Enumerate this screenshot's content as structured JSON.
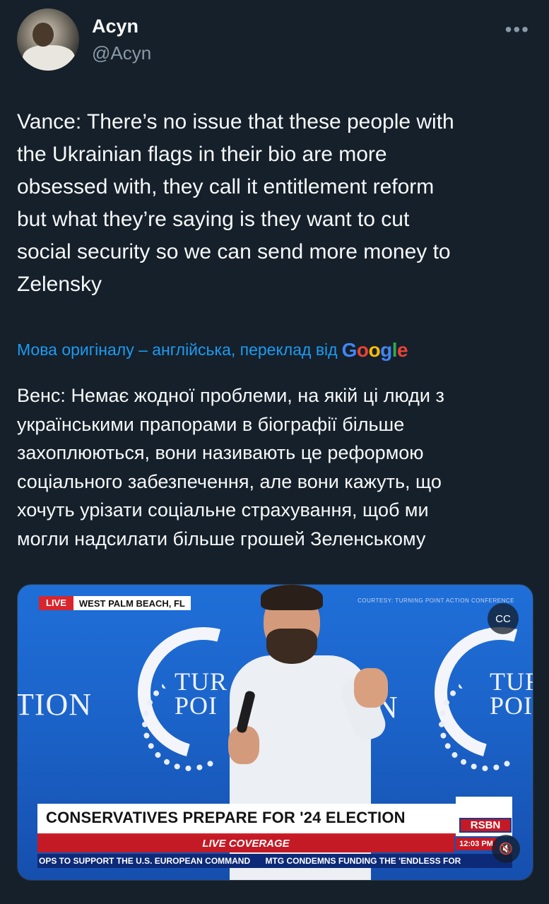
{
  "author": {
    "display_name": "Acyn",
    "handle": "@Acyn"
  },
  "more_icon": "•••",
  "tweet": {
    "text": "Vance: There’s no issue that these people with\nthe Ukrainian flags in their bio are more\nobsessed with, they call it entitlement reform\nbut what they’re saying is they want to cut\nsocial security so we can send more money to\nZelensky"
  },
  "translation": {
    "label": "Мова оригіналу – англійська, переклад від",
    "provider": "Google",
    "text": "Венс: Немає жодної проблеми, на якій ці люди з\nукраїнськими прапорами в біографії більше\nзахоплюються, вони називають це реформою\nсоціального забезпечення, але вони кажуть, що\nхочуть урізати соціальне страхування, щоб ми\nмогли надсилати більше грошей Зеленському"
  },
  "video": {
    "live_badge": "LIVE",
    "location": "WEST PALM BEACH, FL",
    "courtesy": "COURTESY: TURNING POINT ACTION CONFERENCE",
    "stage_left": "TION",
    "stage_turn_1": "TUR",
    "stage_point_1": "POI",
    "stage_mid": "N",
    "stage_turn_2": "TUR",
    "stage_point_2": "POI",
    "headline": "CONSERVATIVES PREPARE FOR '24 ELECTION",
    "network": "RSBN",
    "live_coverage": "LIVE COVERAGE",
    "clock": "12:03 PM",
    "ticker_1": "OPS TO SUPPORT THE U.S. EUROPEAN COMMAND",
    "ticker_2": "MTG CONDEMNS FUNDING THE 'ENDLESS FOR",
    "cc_icon": "CC",
    "mute_icon": "🔇"
  }
}
